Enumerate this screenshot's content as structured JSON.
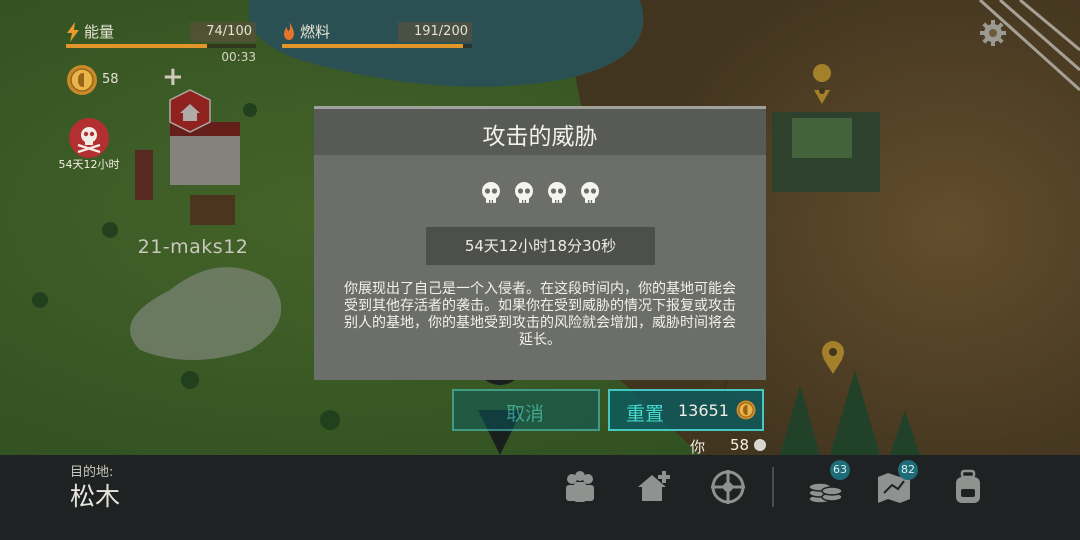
{
  "hud": {
    "energy": {
      "label": "能量",
      "value": "74/100",
      "timer": "00:33",
      "level": 0.74
    },
    "fuel": {
      "label": "燃料",
      "value": "191/200",
      "level": 0.955
    },
    "coins": {
      "count": "58",
      "plus": "+"
    },
    "raid_timer": "54天12小时",
    "settings_icon": "gear-icon"
  },
  "map": {
    "base_name": "21-maks12",
    "home_icon": "home-icon",
    "pin_icon": "location-pin-icon"
  },
  "modal": {
    "title": "攻击的威胁",
    "skull_icon": "skull-icon",
    "threat_level": 4,
    "timer": "54天12小时18分30秒",
    "description": "你展现出了自己是一个入侵者。在这段时间内，你的基地可能会受到其他存活者的袭击。如果你在受到威胁的情况下报复或攻击别人的基地，你的基地受到攻击的风险就会增加，威胁时间将会延长。",
    "cancel_label": "取消",
    "reset_label": "重置",
    "reset_cost": "13651"
  },
  "wallet": {
    "label": "你有",
    "count": "58"
  },
  "bottom_bar": {
    "destination_label": "目的地:",
    "destination_name": "松木",
    "icons": [
      {
        "name": "survivors-icon"
      },
      {
        "name": "add-base-icon"
      },
      {
        "name": "target-icon"
      },
      {
        "name": "coins-icon",
        "badge": "63"
      },
      {
        "name": "map-icon",
        "badge": "82"
      },
      {
        "name": "backpack-icon"
      }
    ]
  },
  "colors": {
    "accent": "#46c7c0",
    "energy_bar": "#e2962a",
    "modal_bg": "#6c6e69",
    "modal_header": "#575a55",
    "danger": "#b42f2f"
  }
}
